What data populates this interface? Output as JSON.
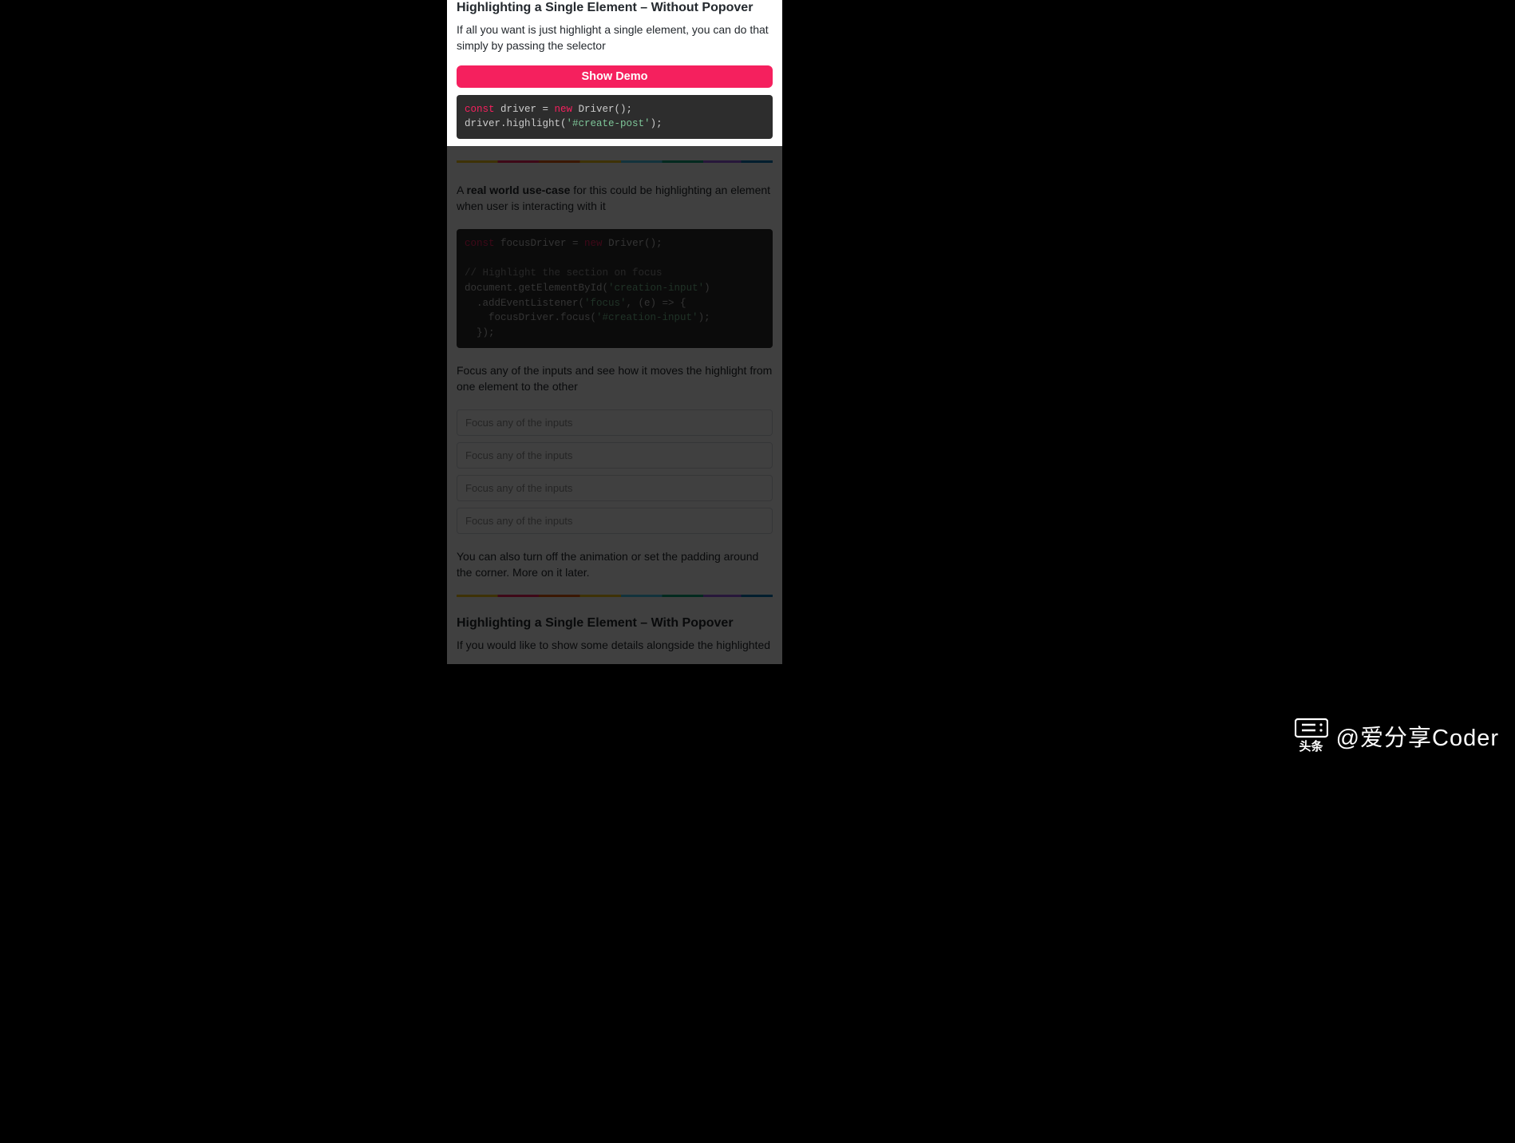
{
  "highlighted": {
    "title": "Highlighting a Single Element – Without Popover",
    "description": "If all you want is just highlight a single element, you can do that simply by passing the selector",
    "button_label": "Show Demo",
    "code": {
      "const_kw": "const",
      "var1": " driver = ",
      "new_kw": "new",
      "ctor": " Driver();",
      "line2a": "driver.highlight(",
      "string1": "'#create-post'",
      "line2b": ");"
    }
  },
  "realworld": {
    "text_prefix": "A ",
    "text_bold": "real world use-case",
    "text_suffix": " for this could be highlighting an element when user is interacting with it",
    "code": {
      "const_kw": "const",
      "line1": " focusDriver = ",
      "new_kw": "new",
      "ctor": " Driver();",
      "comment": "// Highlight the section on focus",
      "line3a": "document",
      "line3b": ".getElementById(",
      "string1": "'creation-input'",
      "line3c": ")",
      "line4a": "  .addEventListener(",
      "string2": "'focus'",
      "line4b": ", (e) => {",
      "line5a": "    focusDriver.focus(",
      "string3": "'#creation-input'",
      "line5b": ");",
      "line6": "  });"
    }
  },
  "focus_text": "Focus any of the inputs and see how it moves the highlight from one element to the other",
  "input_placeholder": "Focus any of the inputs",
  "animation_text": "You can also turn off the animation or set the padding around the corner. More on it later.",
  "with_popover": {
    "title": "Highlighting a Single Element – With Popover",
    "description": "If you would like to show some details alongside the highlighted"
  },
  "watermark": {
    "icon_label": "头条",
    "text": "@爱分享Coder"
  }
}
